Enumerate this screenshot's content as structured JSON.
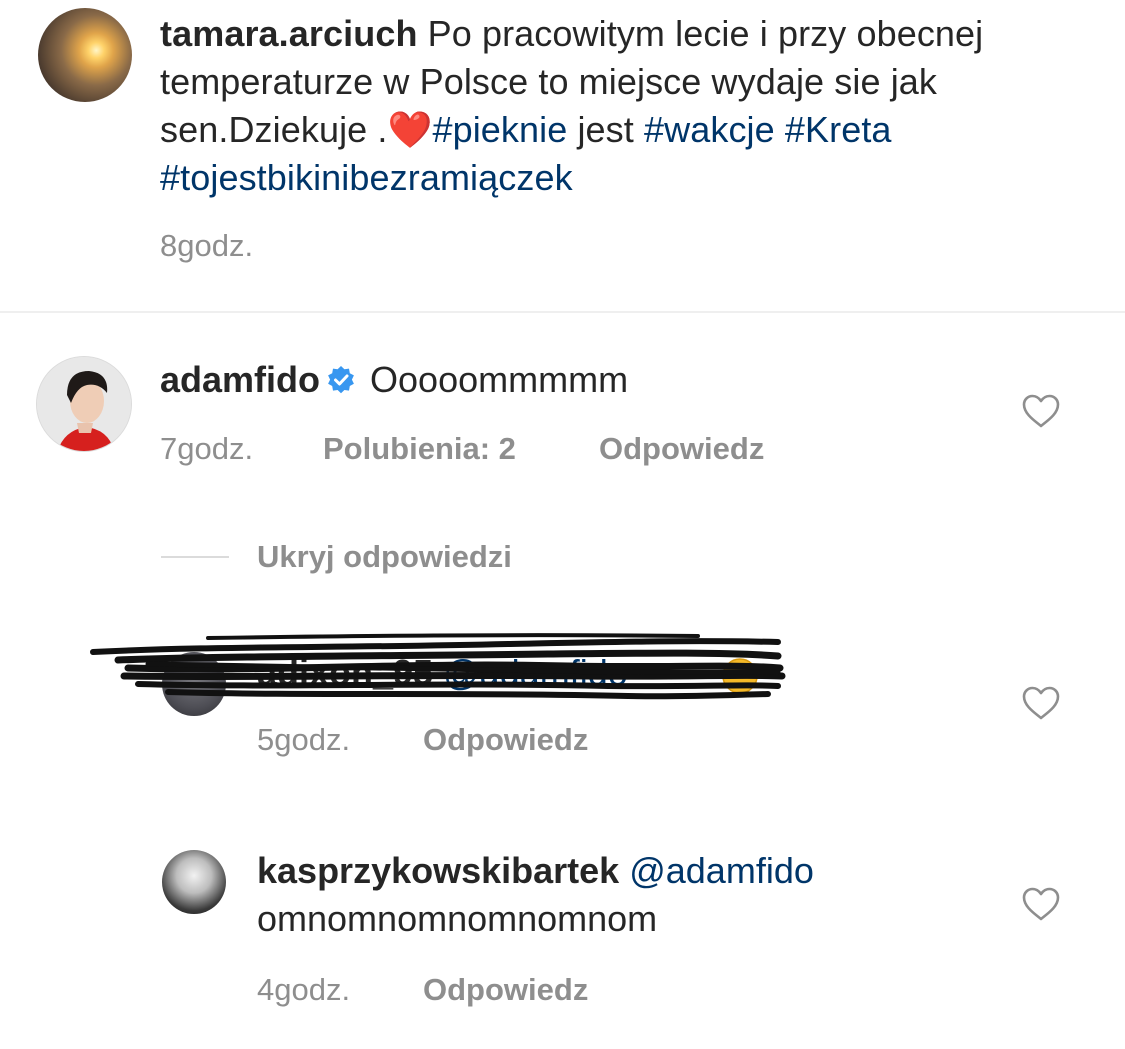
{
  "caption": {
    "username": "tamara.arciuch",
    "text_part1": " Po pracowitym lecie  i przy obecnej temperaturze w Polsce to miejsce wydaje sie jak sen.Dziekuje .",
    "heart_emoji": "❤️",
    "tag_pieknie": "#pieknie",
    "text_part2": " jest ",
    "tag_wakcje": "#wakcje",
    "tag_kreta": "#Kreta",
    "tag_bikini": "#tojestbikinibezramiączek",
    "time": "8godz."
  },
  "comments": [
    {
      "username": "adamfido",
      "verified": true,
      "text": "Ooooommmmm",
      "time": "7godz.",
      "likes": "Polubienia: 2",
      "reply": "Odpowiedz"
    }
  ],
  "hide_replies": "Ukryj odpowiedzi",
  "replies": [
    {
      "username": "adixon_95",
      "mention": "@adamfido",
      "time": "5godz.",
      "reply": "Odpowiedz"
    },
    {
      "username": "kasprzykowskibartek",
      "mention": "@adamfido",
      "text": "omnomnomnomnomnom",
      "time": "4godz.",
      "reply": "Odpowiedz"
    }
  ],
  "colors": {
    "text": "#262626",
    "hashtag": "#003569",
    "meta": "#8e8e8e",
    "verified": "#3897f0",
    "heart": "#e0142a"
  }
}
